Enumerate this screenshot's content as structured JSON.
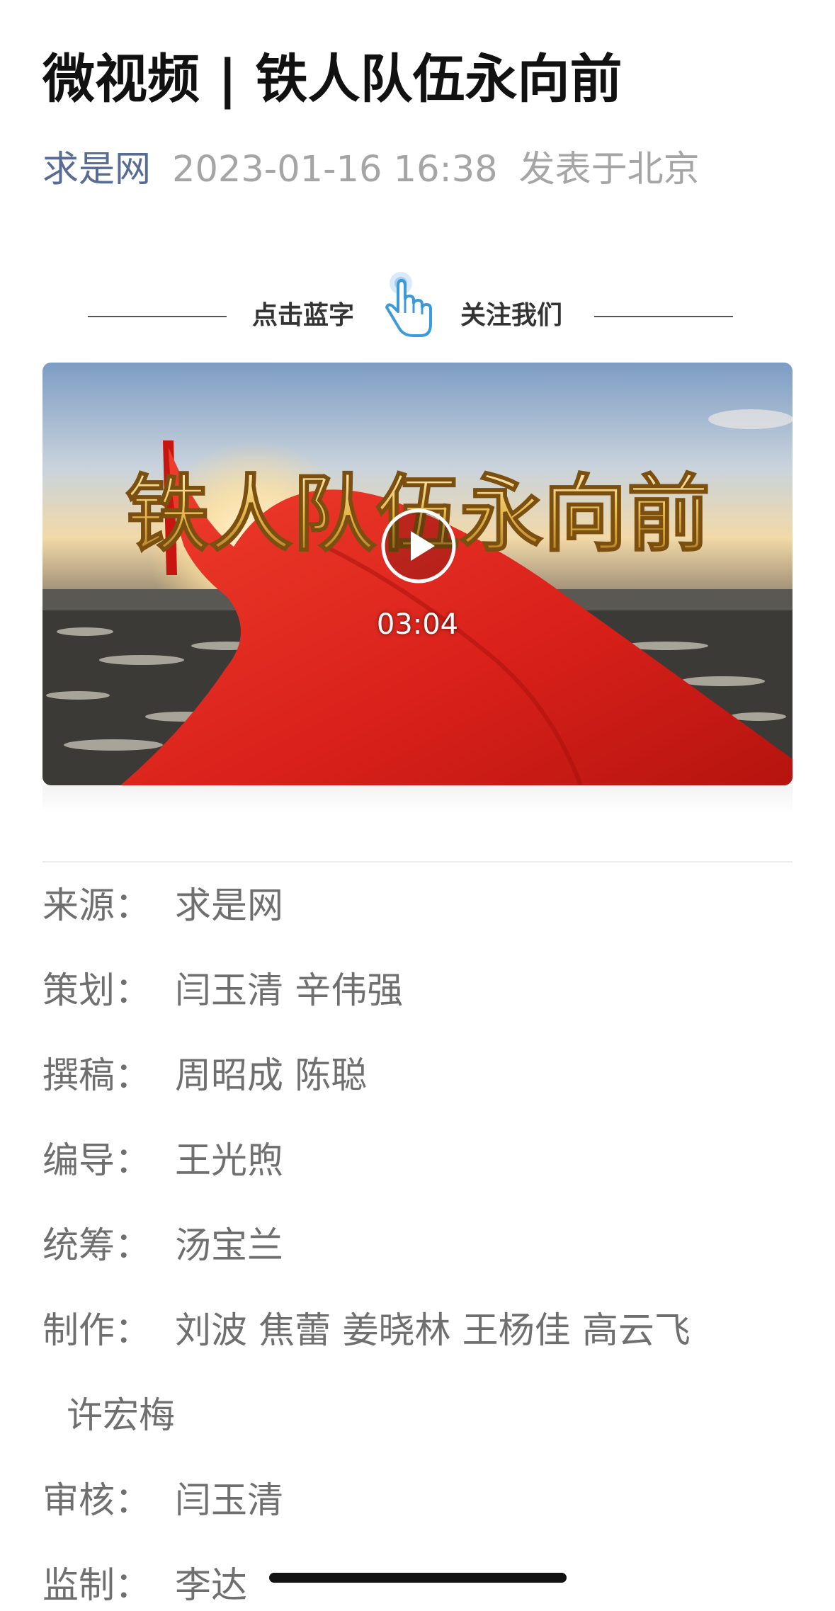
{
  "article": {
    "title": "微视频 | 铁人队伍永向前",
    "author": "求是网",
    "datetime": "2023-01-16 16:38",
    "location": "发表于北京"
  },
  "follow_banner": {
    "left_text": "点击蓝字",
    "right_text": "关注我们",
    "icon": "tap-hand-icon"
  },
  "video": {
    "duration": "03:04",
    "overlay_title": "铁人队伍永向前",
    "icon": "play-icon"
  },
  "credits": [
    {
      "label": "来源：",
      "value": "求是网"
    },
    {
      "label": "策划：",
      "value": "闫玉清  辛伟强"
    },
    {
      "label": "撰稿：",
      "value": "周昭成  陈聪"
    },
    {
      "label": "编导：",
      "value": "王光煦"
    },
    {
      "label": "统筹：",
      "value": "汤宝兰"
    },
    {
      "label": "制作：",
      "value": "刘波  焦蕾  姜晓林  王杨佳  高云飞"
    },
    {
      "label": "",
      "value": "许宏梅"
    },
    {
      "label": "审核：",
      "value": "闫玉清"
    },
    {
      "label": "监制：",
      "value": "李达"
    }
  ],
  "colors": {
    "author_link": "#576b95",
    "meta_gray": "#a5a5a5",
    "credit_text": "#6f6f6f",
    "flag_red": "#e2221a"
  }
}
